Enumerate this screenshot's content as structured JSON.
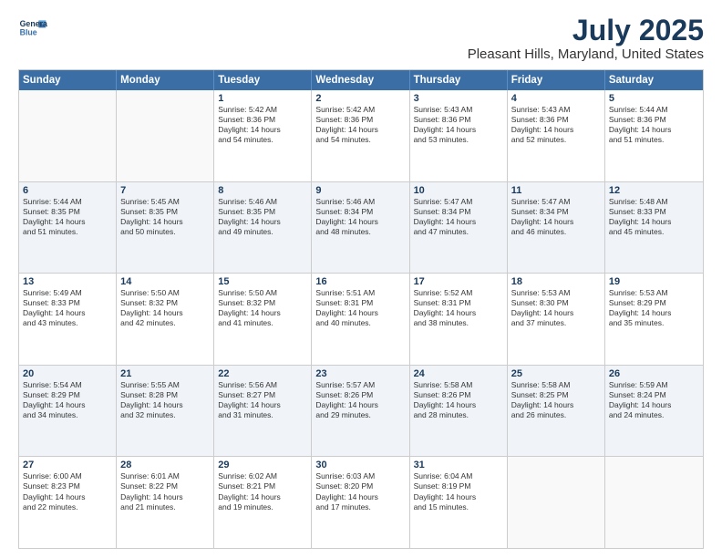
{
  "logo": {
    "line1": "General",
    "line2": "Blue"
  },
  "title": "July 2025",
  "subtitle": "Pleasant Hills, Maryland, United States",
  "days": [
    "Sunday",
    "Monday",
    "Tuesday",
    "Wednesday",
    "Thursday",
    "Friday",
    "Saturday"
  ],
  "weeks": [
    [
      {
        "day": "",
        "info": ""
      },
      {
        "day": "",
        "info": ""
      },
      {
        "day": "1",
        "info": "Sunrise: 5:42 AM\nSunset: 8:36 PM\nDaylight: 14 hours\nand 54 minutes."
      },
      {
        "day": "2",
        "info": "Sunrise: 5:42 AM\nSunset: 8:36 PM\nDaylight: 14 hours\nand 54 minutes."
      },
      {
        "day": "3",
        "info": "Sunrise: 5:43 AM\nSunset: 8:36 PM\nDaylight: 14 hours\nand 53 minutes."
      },
      {
        "day": "4",
        "info": "Sunrise: 5:43 AM\nSunset: 8:36 PM\nDaylight: 14 hours\nand 52 minutes."
      },
      {
        "day": "5",
        "info": "Sunrise: 5:44 AM\nSunset: 8:36 PM\nDaylight: 14 hours\nand 51 minutes."
      }
    ],
    [
      {
        "day": "6",
        "info": "Sunrise: 5:44 AM\nSunset: 8:35 PM\nDaylight: 14 hours\nand 51 minutes."
      },
      {
        "day": "7",
        "info": "Sunrise: 5:45 AM\nSunset: 8:35 PM\nDaylight: 14 hours\nand 50 minutes."
      },
      {
        "day": "8",
        "info": "Sunrise: 5:46 AM\nSunset: 8:35 PM\nDaylight: 14 hours\nand 49 minutes."
      },
      {
        "day": "9",
        "info": "Sunrise: 5:46 AM\nSunset: 8:34 PM\nDaylight: 14 hours\nand 48 minutes."
      },
      {
        "day": "10",
        "info": "Sunrise: 5:47 AM\nSunset: 8:34 PM\nDaylight: 14 hours\nand 47 minutes."
      },
      {
        "day": "11",
        "info": "Sunrise: 5:47 AM\nSunset: 8:34 PM\nDaylight: 14 hours\nand 46 minutes."
      },
      {
        "day": "12",
        "info": "Sunrise: 5:48 AM\nSunset: 8:33 PM\nDaylight: 14 hours\nand 45 minutes."
      }
    ],
    [
      {
        "day": "13",
        "info": "Sunrise: 5:49 AM\nSunset: 8:33 PM\nDaylight: 14 hours\nand 43 minutes."
      },
      {
        "day": "14",
        "info": "Sunrise: 5:50 AM\nSunset: 8:32 PM\nDaylight: 14 hours\nand 42 minutes."
      },
      {
        "day": "15",
        "info": "Sunrise: 5:50 AM\nSunset: 8:32 PM\nDaylight: 14 hours\nand 41 minutes."
      },
      {
        "day": "16",
        "info": "Sunrise: 5:51 AM\nSunset: 8:31 PM\nDaylight: 14 hours\nand 40 minutes."
      },
      {
        "day": "17",
        "info": "Sunrise: 5:52 AM\nSunset: 8:31 PM\nDaylight: 14 hours\nand 38 minutes."
      },
      {
        "day": "18",
        "info": "Sunrise: 5:53 AM\nSunset: 8:30 PM\nDaylight: 14 hours\nand 37 minutes."
      },
      {
        "day": "19",
        "info": "Sunrise: 5:53 AM\nSunset: 8:29 PM\nDaylight: 14 hours\nand 35 minutes."
      }
    ],
    [
      {
        "day": "20",
        "info": "Sunrise: 5:54 AM\nSunset: 8:29 PM\nDaylight: 14 hours\nand 34 minutes."
      },
      {
        "day": "21",
        "info": "Sunrise: 5:55 AM\nSunset: 8:28 PM\nDaylight: 14 hours\nand 32 minutes."
      },
      {
        "day": "22",
        "info": "Sunrise: 5:56 AM\nSunset: 8:27 PM\nDaylight: 14 hours\nand 31 minutes."
      },
      {
        "day": "23",
        "info": "Sunrise: 5:57 AM\nSunset: 8:26 PM\nDaylight: 14 hours\nand 29 minutes."
      },
      {
        "day": "24",
        "info": "Sunrise: 5:58 AM\nSunset: 8:26 PM\nDaylight: 14 hours\nand 28 minutes."
      },
      {
        "day": "25",
        "info": "Sunrise: 5:58 AM\nSunset: 8:25 PM\nDaylight: 14 hours\nand 26 minutes."
      },
      {
        "day": "26",
        "info": "Sunrise: 5:59 AM\nSunset: 8:24 PM\nDaylight: 14 hours\nand 24 minutes."
      }
    ],
    [
      {
        "day": "27",
        "info": "Sunrise: 6:00 AM\nSunset: 8:23 PM\nDaylight: 14 hours\nand 22 minutes."
      },
      {
        "day": "28",
        "info": "Sunrise: 6:01 AM\nSunset: 8:22 PM\nDaylight: 14 hours\nand 21 minutes."
      },
      {
        "day": "29",
        "info": "Sunrise: 6:02 AM\nSunset: 8:21 PM\nDaylight: 14 hours\nand 19 minutes."
      },
      {
        "day": "30",
        "info": "Sunrise: 6:03 AM\nSunset: 8:20 PM\nDaylight: 14 hours\nand 17 minutes."
      },
      {
        "day": "31",
        "info": "Sunrise: 6:04 AM\nSunset: 8:19 PM\nDaylight: 14 hours\nand 15 minutes."
      },
      {
        "day": "",
        "info": ""
      },
      {
        "day": "",
        "info": ""
      }
    ]
  ]
}
